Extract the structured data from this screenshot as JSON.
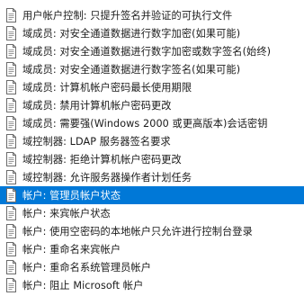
{
  "colors": {
    "selection_background": "#0078d7",
    "selection_text": "#ffffff",
    "text": "#1a1a1a",
    "icon_border": "#6b6b6b",
    "icon_lines": "#9a9a9a"
  },
  "policies": [
    {
      "label": "用户帐户控制: 只提升签名并验证的可执行文件",
      "icon": "policy-document-icon",
      "selected": false
    },
    {
      "label": "域成员: 对安全通道数据进行数字加密(如果可能)",
      "icon": "policy-document-icon",
      "selected": false
    },
    {
      "label": "域成员: 对安全通道数据进行数字加密或数字签名(始终)",
      "icon": "policy-document-icon",
      "selected": false
    },
    {
      "label": "域成员: 对安全通道数据进行数字签名(如果可能)",
      "icon": "policy-document-icon",
      "selected": false
    },
    {
      "label": "域成员: 计算机帐户密码最长使用期限",
      "icon": "policy-document-icon",
      "selected": false
    },
    {
      "label": "域成员: 禁用计算机帐户密码更改",
      "icon": "policy-document-icon",
      "selected": false
    },
    {
      "label": "域成员: 需要强(Windows 2000 或更高版本)会话密钥",
      "icon": "policy-document-icon",
      "selected": false
    },
    {
      "label": "域控制器: LDAP 服务器签名要求",
      "icon": "policy-document-icon",
      "selected": false
    },
    {
      "label": "域控制器: 拒绝计算机帐户密码更改",
      "icon": "policy-document-icon",
      "selected": false
    },
    {
      "label": "域控制器: 允许服务器操作者计划任务",
      "icon": "policy-document-icon",
      "selected": false
    },
    {
      "label": "帐户: 管理员帐户状态",
      "icon": "policy-document-icon",
      "selected": true
    },
    {
      "label": "帐户: 来宾帐户状态",
      "icon": "policy-document-icon",
      "selected": false
    },
    {
      "label": "帐户: 使用空密码的本地帐户只允许进行控制台登录",
      "icon": "policy-document-icon",
      "selected": false
    },
    {
      "label": "帐户: 重命名来宾帐户",
      "icon": "policy-document-icon",
      "selected": false
    },
    {
      "label": "帐户: 重命名系统管理员帐户",
      "icon": "policy-document-icon",
      "selected": false
    },
    {
      "label": "帐户: 阻止 Microsoft 帐户",
      "icon": "policy-document-icon",
      "selected": false
    }
  ]
}
